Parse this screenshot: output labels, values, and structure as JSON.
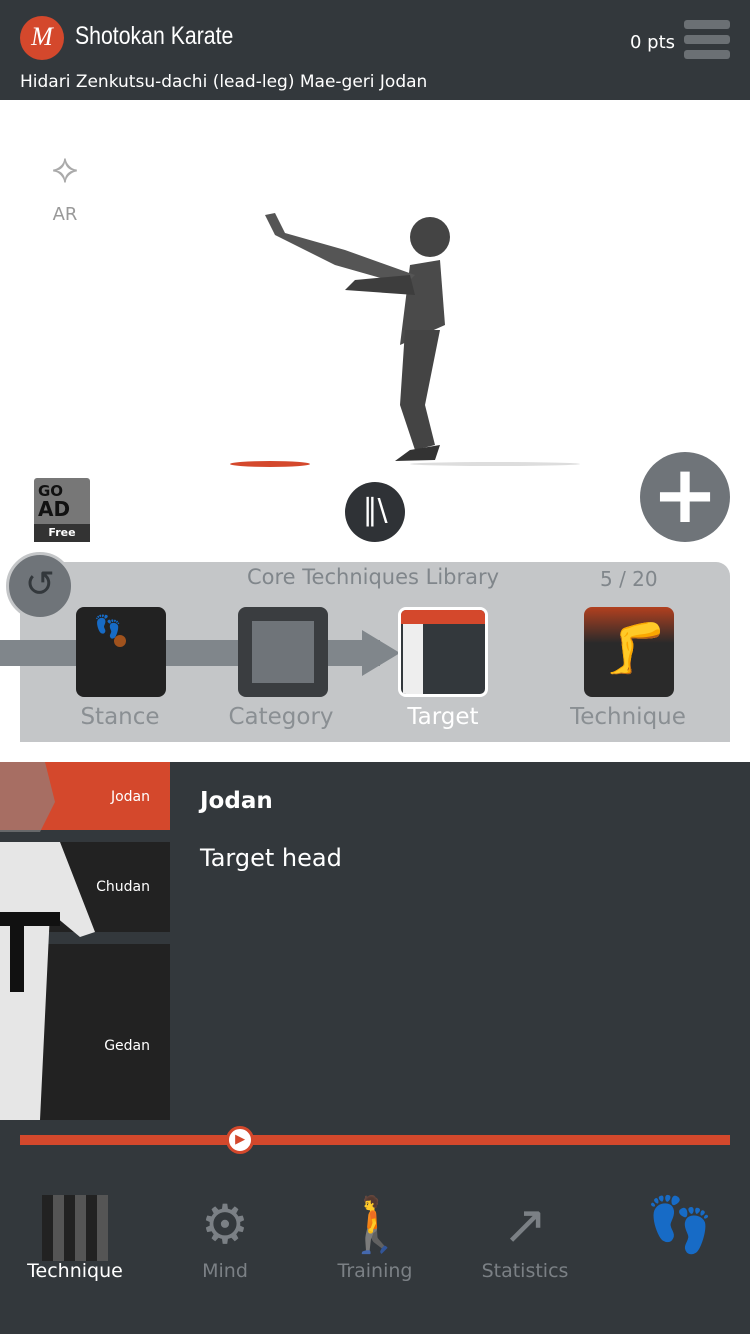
{
  "header": {
    "app_title": "Shotokan Karate",
    "points": "0 pts",
    "subtitle": "Hidari Zenkutsu-dachi (lead-leg) Mae-geri Jodan",
    "logo_text": "M"
  },
  "viewer": {
    "ar_label": "AR",
    "go_ad": {
      "line1": "GO",
      "line2": "AD",
      "badge": "Free"
    }
  },
  "library": {
    "title": "Core Techniques Library",
    "count": "5 / 20",
    "steps": [
      {
        "label": "Stance"
      },
      {
        "label": "Category"
      },
      {
        "label": "Target",
        "active": true
      },
      {
        "label": "Technique"
      }
    ]
  },
  "targets": [
    {
      "label": "Jodan",
      "active": true
    },
    {
      "label": "Chudan"
    },
    {
      "label": "Gedan"
    }
  ],
  "detail": {
    "title": "Jodan",
    "description": "Target head"
  },
  "playback": {
    "progress_percent": 31
  },
  "tabs": [
    {
      "label": "Technique",
      "icon": "technique-icon",
      "active": true
    },
    {
      "label": "Mind",
      "icon": "mind-icon"
    },
    {
      "label": "Training",
      "icon": "training-icon"
    },
    {
      "label": "Statistics",
      "icon": "statistics-icon"
    },
    {
      "label": "",
      "icon": "footprints-icon"
    }
  ],
  "colors": {
    "accent": "#d4482c",
    "header_bg": "#33383c",
    "panel_bg": "#c4c6c8"
  }
}
